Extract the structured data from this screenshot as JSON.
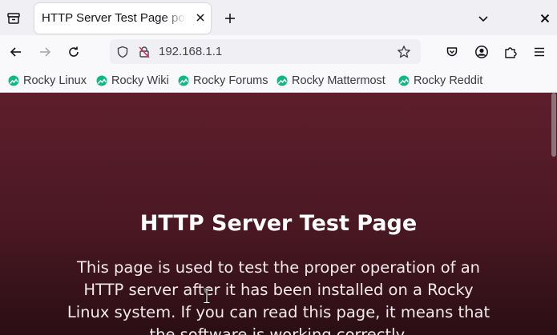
{
  "tab": {
    "title": "HTTP Server Test Page powered by Rocky Linux"
  },
  "navbar": {
    "url": "192.168.1.1"
  },
  "bookmarks": [
    {
      "label": "Rocky Linux"
    },
    {
      "label": "Rocky Wiki"
    },
    {
      "label": "Rocky Forums"
    },
    {
      "label": "Rocky Mattermost"
    },
    {
      "label": "Rocky Reddit"
    }
  ],
  "page": {
    "heading": "HTTP Server Test Page",
    "paragraph": "This page is used to test the proper operation of an HTTP server after it has been installed on a Rocky Linux system. If you can read this page, it means that the software is working correctly."
  },
  "colors": {
    "page_bg": "#4a1823",
    "bookmark_icon": "#10b981"
  }
}
